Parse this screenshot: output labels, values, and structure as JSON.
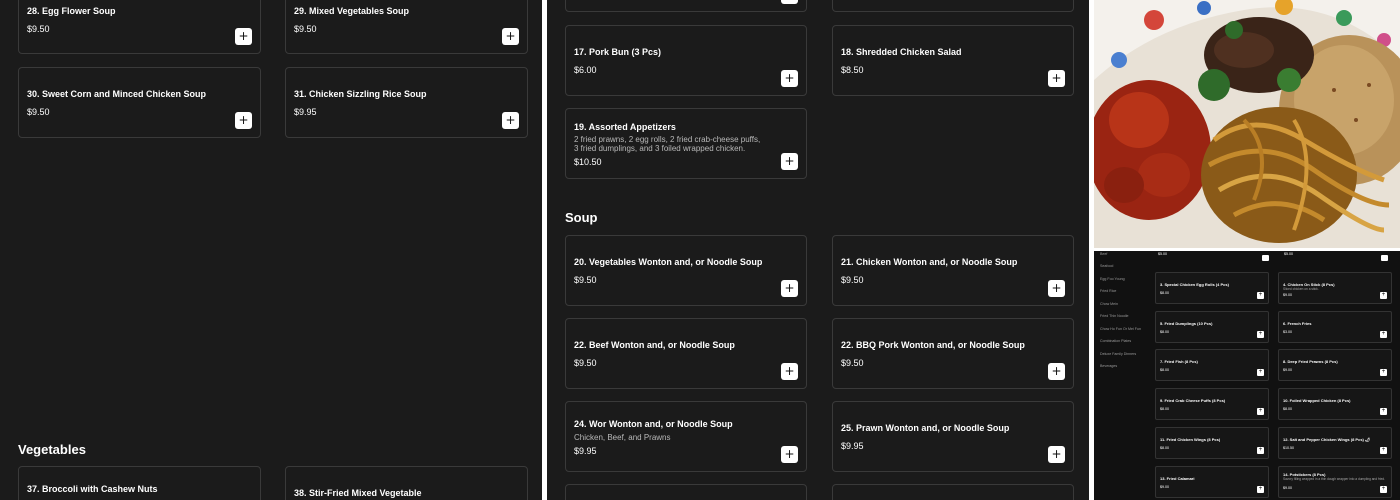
{
  "left_panel": {
    "cards": [
      {
        "title": "28. Egg Flower Soup",
        "price": "$9.50"
      },
      {
        "title": "29. Mixed Vegetables Soup",
        "price": "$9.50"
      },
      {
        "title": "30. Sweet Corn and Minced Chicken Soup",
        "price": "$9.50"
      },
      {
        "title": "31. Chicken Sizzling Rice Soup",
        "price": "$9.95"
      },
      {
        "title": "37. Broccoli with Cashew Nuts",
        "price": ""
      },
      {
        "title": "38. Stir-Fried Mixed Vegetable",
        "price": ""
      }
    ],
    "vegetables_heading": "Vegetables"
  },
  "middle_panel": {
    "cards": [
      {
        "title": "17. Pork Bun (3 Pcs)",
        "price": "$6.00",
        "desc": ""
      },
      {
        "title": "18. Shredded Chicken Salad",
        "price": "$8.50",
        "desc": ""
      },
      {
        "title": "19. Assorted Appetizers",
        "price": "$10.50",
        "desc": "2 fried prawns, 2 egg rolls, 2 fried crab-cheese puffs, 3 fried dumplings, and 3 foiled wrapped chicken."
      },
      {
        "title": "20. Vegetables Wonton and, or Noodle Soup",
        "price": "$9.50",
        "desc": ""
      },
      {
        "title": "21. Chicken Wonton and, or Noodle Soup",
        "price": "$9.50",
        "desc": ""
      },
      {
        "title": "22. Beef Wonton and, or Noodle Soup",
        "price": "$9.50",
        "desc": ""
      },
      {
        "title": "22. BBQ Pork Wonton and, or Noodle Soup",
        "price": "$9.50",
        "desc": ""
      },
      {
        "title": "24. Wor Wonton and, or Noodle Soup",
        "price": "$9.95",
        "desc": "Chicken, Beef, and Prawns"
      },
      {
        "title": "25. Prawn Wonton and, or Noodle Soup",
        "price": "$9.95",
        "desc": ""
      }
    ],
    "soup_heading": "Soup"
  },
  "add_button_label": "+",
  "mini_panel": {
    "sidebar": [
      "Beef",
      "Seafood",
      "Egg Foo Young",
      "Fried Rice",
      "Chow Mein",
      "Fried Thin Noodle",
      "Chow Ho Fun Or Mei Fun",
      "Combination Plates",
      "Deluxe Family Dinners",
      "Beverages"
    ],
    "top_prices": [
      "$5.00",
      "$5.00"
    ],
    "cards": [
      {
        "title": "3. Special Chicken Egg Rolls (4 Pcs)",
        "desc": "",
        "price": "$8.00"
      },
      {
        "title": "4. Chicken On Stick (8 Pcs)",
        "desc": "Sliced chicken on a stick.",
        "price": "$9.00"
      },
      {
        "title": "5. Fried Dumplings (10 Pcs)",
        "desc": "",
        "price": "$8.00"
      },
      {
        "title": "6. French Fries",
        "desc": "",
        "price": "$3.00"
      },
      {
        "title": "7. Fried Fish (8 Pcs)",
        "desc": "",
        "price": "$8.00"
      },
      {
        "title": "8. Deep Fried Prawns (8 Pcs)",
        "desc": "",
        "price": "$9.00"
      },
      {
        "title": "9. Fried Crab Cheese Puffs (8 Pcs)",
        "desc": "",
        "price": "$8.00"
      },
      {
        "title": "10. Foiled Wrapped Chicken (8 Pcs)",
        "desc": "",
        "price": "$8.00"
      },
      {
        "title": "11. Fried Chicken Wings (8 Pcs)",
        "desc": "",
        "price": "$8.00"
      },
      {
        "title": "12. Salt and Pepper Chicken Wings (8 Pcs) 🌶",
        "desc": "",
        "price": "$10.50"
      },
      {
        "title": "13. Fried Calamari",
        "desc": "",
        "price": "$9.00"
      },
      {
        "title": "14. Potstickers (8 Pcs)",
        "desc": "Savory filling wrapped in a thin dough wrapper into a dumpling and fried.",
        "price": "$9.00"
      }
    ]
  }
}
